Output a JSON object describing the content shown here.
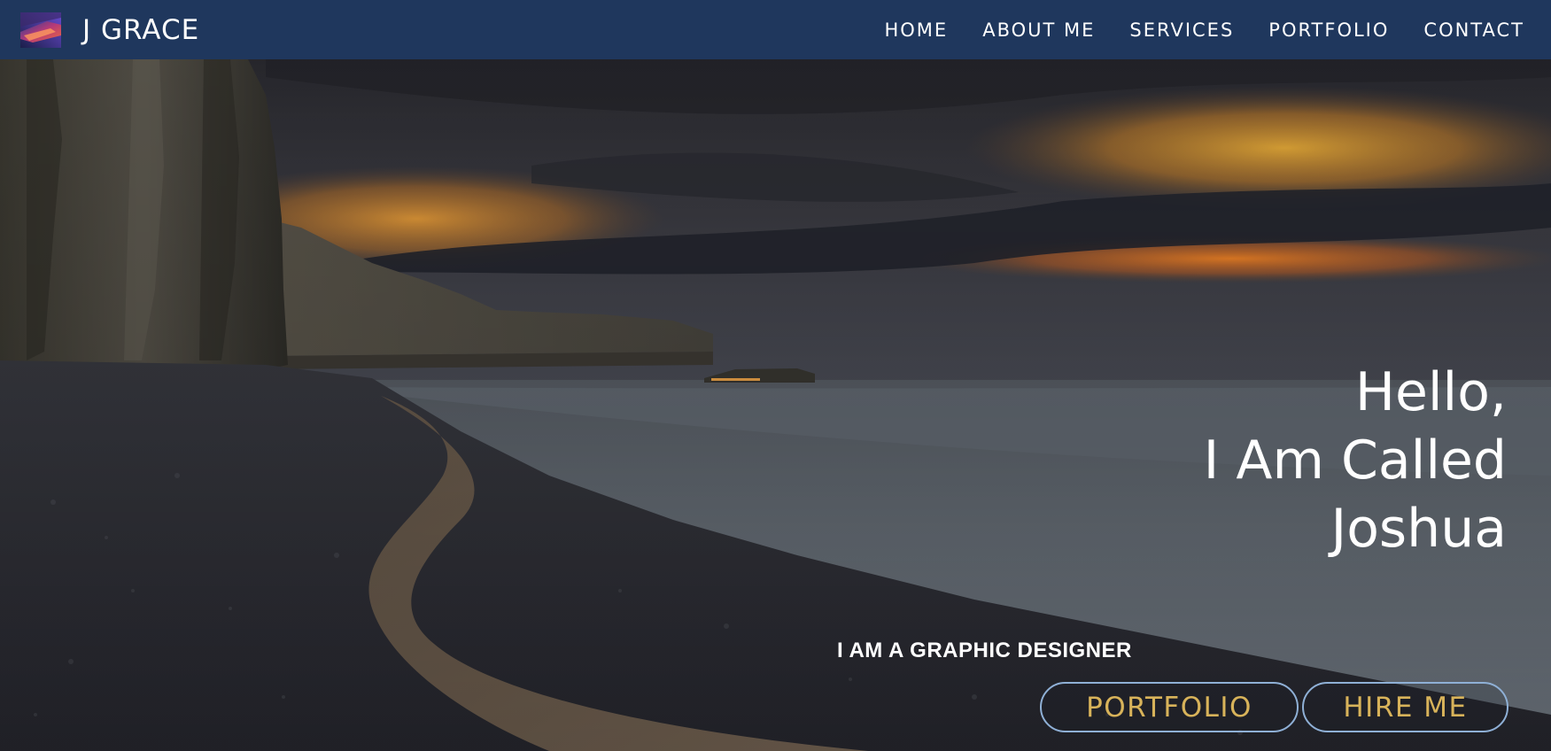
{
  "brand": {
    "name": "J GRACE",
    "logo_icon": "abstract-gradient-logo-icon"
  },
  "nav": {
    "items": [
      {
        "label": "HOME"
      },
      {
        "label": "ABOUT ME"
      },
      {
        "label": "SERVICES"
      },
      {
        "label": "PORTFOLIO"
      },
      {
        "label": "CONTACT"
      }
    ]
  },
  "hero": {
    "greeting_lines": [
      "Hello,",
      "I Am Called",
      "Joshua"
    ],
    "tagline": "I AM A GRAPHIC DESIGNER",
    "buttons": {
      "portfolio": "PORTFOLIO",
      "hire": "HIRE ME"
    },
    "background": "sunset-coastal-cliffs-beach-photo"
  },
  "colors": {
    "navbar_bg": "#1f375d",
    "button_text": "#d8b35a",
    "button_border": "#8fb0d6",
    "text": "#ffffff"
  }
}
